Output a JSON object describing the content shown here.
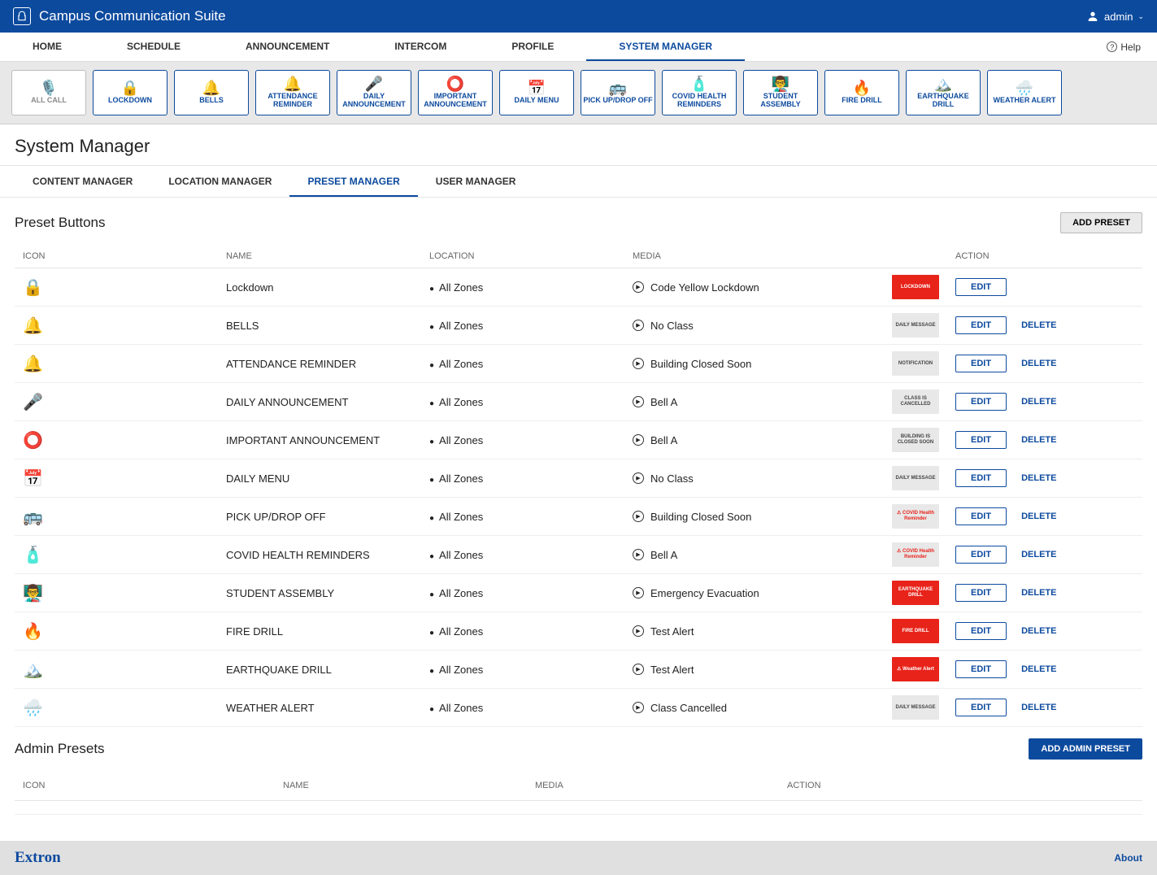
{
  "header": {
    "title": "Campus Communication Suite",
    "user": "admin"
  },
  "topnav": {
    "items": [
      "HOME",
      "SCHEDULE",
      "ANNOUNCEMENT",
      "INTERCOM",
      "PROFILE",
      "SYSTEM MANAGER"
    ],
    "active": 5,
    "help": "Help"
  },
  "preset_bar": [
    {
      "label": "ALL CALL",
      "icon": "🎙️",
      "inactive": true
    },
    {
      "label": "LOCKDOWN",
      "icon": "🔒"
    },
    {
      "label": "BELLS",
      "icon": "🔔"
    },
    {
      "label": "ATTENDANCE REMINDER",
      "icon": "🔔"
    },
    {
      "label": "DAILY ANNOUNCEMENT",
      "icon": "🎤"
    },
    {
      "label": "IMPORTANT ANNOUNCEMENT",
      "icon": "⭕"
    },
    {
      "label": "DAILY MENU",
      "icon": "📅"
    },
    {
      "label": "PICK UP/DROP OFF",
      "icon": "🚌"
    },
    {
      "label": "COVID HEALTH REMINDERS",
      "icon": "🧴"
    },
    {
      "label": "STUDENT ASSEMBLY",
      "icon": "👨‍🏫"
    },
    {
      "label": "FIRE DRILL",
      "icon": "🔥"
    },
    {
      "label": "EARTHQUAKE DRILL",
      "icon": "🏔️"
    },
    {
      "label": "WEATHER ALERT",
      "icon": "🌧️"
    }
  ],
  "page": {
    "title": "System Manager"
  },
  "subtabs": {
    "items": [
      "CONTENT MANAGER",
      "LOCATION MANAGER",
      "PRESET MANAGER",
      "USER MANAGER"
    ],
    "active": 2
  },
  "presets": {
    "title": "Preset Buttons",
    "add_label": "ADD PRESET",
    "edit_label": "EDIT",
    "delete_label": "DELETE",
    "columns": [
      "ICON",
      "NAME",
      "LOCATION",
      "MEDIA",
      "ACTION"
    ],
    "rows": [
      {
        "icon": "🔒",
        "name": "Lockdown",
        "location": "All Zones",
        "media": "Code Yellow Lockdown",
        "thumb": {
          "text": "LOCKDOWN",
          "style": "red"
        },
        "no_delete": true
      },
      {
        "icon": "🔔",
        "name": "BELLS",
        "location": "All Zones",
        "media": "No Class",
        "thumb": {
          "text": "DAILY MESSAGE",
          "style": "gray"
        }
      },
      {
        "icon": "🔔",
        "name": "ATTENDANCE REMINDER",
        "location": "All Zones",
        "media": "Building Closed Soon",
        "thumb": {
          "text": "NOTIFICATION",
          "style": "gray"
        }
      },
      {
        "icon": "🎤",
        "name": "DAILY ANNOUNCEMENT",
        "location": "All Zones",
        "media": "Bell A",
        "thumb": {
          "text": "CLASS IS CANCELLED",
          "style": "gray"
        }
      },
      {
        "icon": "⭕",
        "name": "IMPORTANT ANNOUNCEMENT",
        "location": "All Zones",
        "media": "Bell A",
        "thumb": {
          "text": "BUILDING IS CLOSED SOON",
          "style": "gray"
        }
      },
      {
        "icon": "📅",
        "name": "DAILY MENU",
        "location": "All Zones",
        "media": "No Class",
        "thumb": {
          "text": "DAILY MESSAGE",
          "style": "gray"
        }
      },
      {
        "icon": "🚌",
        "name": "PICK UP/DROP OFF",
        "location": "All Zones",
        "media": "Building Closed Soon",
        "thumb": {
          "text": "⚠ COVID Health Reminder",
          "style": "covid"
        }
      },
      {
        "icon": "🧴",
        "name": "COVID HEALTH REMINDERS",
        "location": "All Zones",
        "media": "Bell A",
        "thumb": {
          "text": "⚠ COVID Health Reminder",
          "style": "covid"
        }
      },
      {
        "icon": "👨‍🏫",
        "name": "STUDENT ASSEMBLY",
        "location": "All Zones",
        "media": "Emergency Evacuation",
        "thumb": {
          "text": "EARTHQUAKE DRILL",
          "style": "red"
        }
      },
      {
        "icon": "🔥",
        "name": "FIRE DRILL",
        "location": "All Zones",
        "media": "Test Alert",
        "thumb": {
          "text": "FIRE DRILL",
          "style": "red"
        }
      },
      {
        "icon": "🏔️",
        "name": "EARTHQUAKE DRILL",
        "location": "All Zones",
        "media": "Test Alert",
        "thumb": {
          "text": "⚠ Weather Alert",
          "style": "red"
        }
      },
      {
        "icon": "🌧️",
        "name": "WEATHER ALERT",
        "location": "All Zones",
        "media": "Class Cancelled",
        "thumb": {
          "text": "DAILY MESSAGE",
          "style": "gray"
        }
      }
    ]
  },
  "admin_presets": {
    "title": "Admin Presets",
    "add_label": "ADD ADMIN PRESET",
    "columns": [
      "ICON",
      "NAME",
      "MEDIA",
      "ACTION"
    ]
  },
  "footer": {
    "brand": "Extron",
    "about": "About"
  }
}
